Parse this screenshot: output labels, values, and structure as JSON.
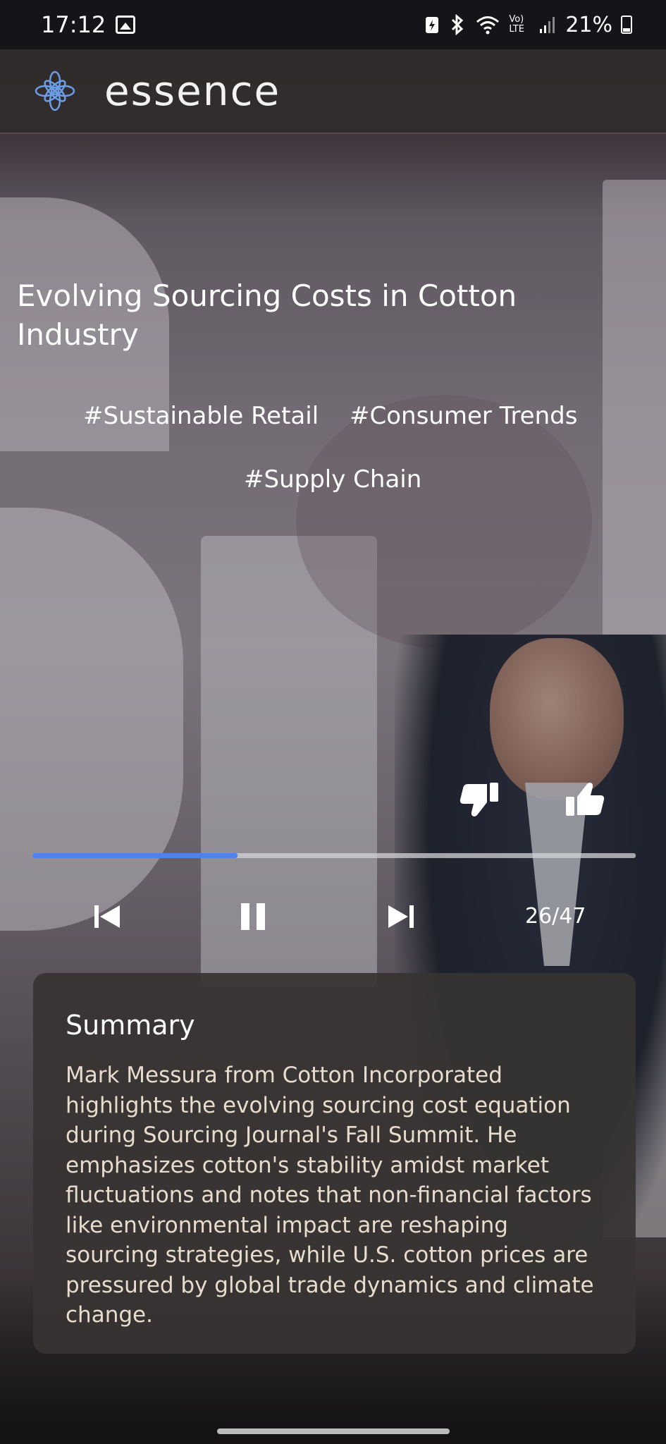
{
  "status_bar": {
    "time": "17:12",
    "signal_text": "Vo) LTE",
    "battery": "21%"
  },
  "app": {
    "brand": "essence",
    "accent_color": "#4d84e8"
  },
  "article": {
    "title": "Evolving Sourcing Costs in Cotton Industry",
    "tags": [
      "#Sustainable Retail",
      "#Consumer Trends",
      "#Supply Chain"
    ]
  },
  "player": {
    "progress_fraction": 0.34,
    "counter": "26/47",
    "icons": [
      "thumbs-down-icon",
      "thumbs-up-icon",
      "skip-previous-icon",
      "pause-icon",
      "skip-next-icon"
    ]
  },
  "summary": {
    "heading": "Summary",
    "body": "Mark Messura from Cotton Incorporated highlights the evolving sourcing cost equation during Sourcing Journal's Fall Summit. He emphasizes cotton's stability amidst market fluctuations and notes that non-financial factors like environmental impact are reshaping sourcing strategies, while U.S. cotton prices are pressured by global trade dynamics and climate change."
  }
}
